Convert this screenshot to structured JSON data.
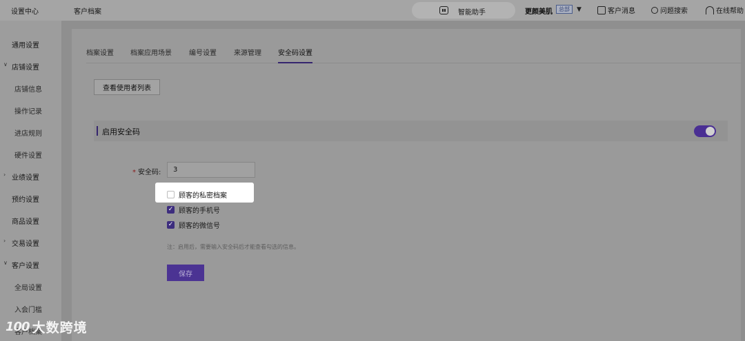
{
  "topbar": {
    "brand": "设置中心",
    "breadcrumb": "客户档案",
    "assistant_label": "智能助手",
    "store_name": "更颜美肌",
    "store_badge": "总部",
    "messages_label": "客户消息",
    "search_label": "问题搜索",
    "help_label": "在线帮助"
  },
  "sidebar": {
    "items": [
      {
        "label": "通用设置",
        "level": "top"
      },
      {
        "label": "店铺设置",
        "level": "group",
        "expanded": true
      },
      {
        "label": "店铺信息",
        "level": "sub"
      },
      {
        "label": "操作记录",
        "level": "sub"
      },
      {
        "label": "进店规则",
        "level": "sub"
      },
      {
        "label": "硬件设置",
        "level": "sub"
      },
      {
        "label": "业绩设置",
        "level": "group",
        "expanded": false
      },
      {
        "label": "预约设置",
        "level": "top"
      },
      {
        "label": "商品设置",
        "level": "top"
      },
      {
        "label": "交易设置",
        "level": "group",
        "expanded": false
      },
      {
        "label": "客户设置",
        "level": "group",
        "expanded": true
      },
      {
        "label": "全局设置",
        "level": "sub"
      },
      {
        "label": "入会门槛",
        "level": "sub"
      },
      {
        "label": "客户档案",
        "level": "sub"
      }
    ]
  },
  "tabs": [
    {
      "label": "档案设置",
      "active": false
    },
    {
      "label": "档案应用场景",
      "active": false
    },
    {
      "label": "编号设置",
      "active": false
    },
    {
      "label": "来源管理",
      "active": false
    },
    {
      "label": "安全码设置",
      "active": true
    }
  ],
  "view_users_button": "查看使用者列表",
  "section": {
    "title": "启用安全码",
    "enabled": true
  },
  "security_code": {
    "label": "安全码:",
    "required_mark": "*",
    "value": "3"
  },
  "options": [
    {
      "label": "顾客的私密档案",
      "checked": false
    },
    {
      "label": "顾客的手机号",
      "checked": true
    },
    {
      "label": "顾客的微信号",
      "checked": true
    }
  ],
  "note": "注：启用后，需要输入安全码后才能查看勾选的信息。",
  "save_button": "保存",
  "watermark": {
    "logo": "100",
    "text": "大数跨境"
  },
  "colors": {
    "accent": "#4b3393",
    "popup_bg": "#ffffff"
  }
}
